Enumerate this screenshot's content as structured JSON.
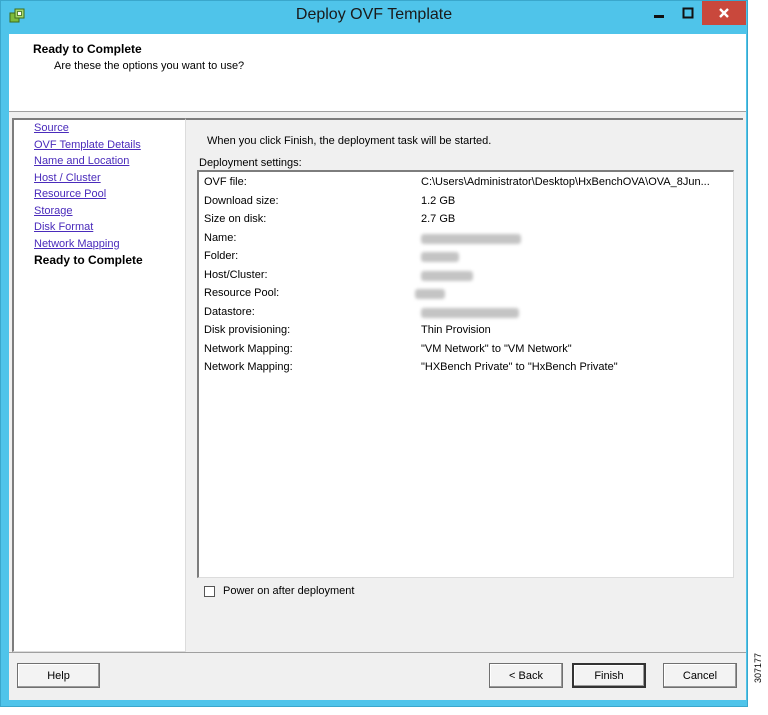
{
  "window": {
    "title": "Deploy OVF Template",
    "app_icon": "vsphere-deploy-icon",
    "controls": [
      "minimize-icon",
      "maximize-icon",
      "close-icon"
    ]
  },
  "header": {
    "title": "Ready to Complete",
    "subtitle": "Are these the options you want to use?"
  },
  "nav": {
    "items": [
      {
        "label": "Source"
      },
      {
        "label": "OVF Template Details"
      },
      {
        "label": "Name and Location"
      },
      {
        "label": "Host / Cluster"
      },
      {
        "label": "Resource Pool"
      },
      {
        "label": "Storage"
      },
      {
        "label": "Disk Format"
      },
      {
        "label": "Network Mapping"
      },
      {
        "label": "Ready to Complete"
      }
    ],
    "current_index": 8
  },
  "main": {
    "intro": "When you click Finish, the deployment task will be started.",
    "settings_label": "Deployment settings:",
    "settings": [
      {
        "key": "OVF file:",
        "value": "C:\\Users\\Administrator\\Desktop\\HxBenchOVA\\OVA_8Jun..."
      },
      {
        "key": "Download size:",
        "value": "1.2 GB"
      },
      {
        "key": "Size on disk:",
        "value": "2.7 GB"
      },
      {
        "key": "Name:",
        "value": ""
      },
      {
        "key": "Folder:",
        "value": ""
      },
      {
        "key": "Host/Cluster:",
        "value": ""
      },
      {
        "key": "Resource Pool:",
        "value": ""
      },
      {
        "key": "Datastore:",
        "value": ""
      },
      {
        "key": "Disk provisioning:",
        "value": "Thin Provision"
      },
      {
        "key": "Network Mapping:",
        "value": "\"VM Network\" to \"VM Network\""
      },
      {
        "key": "Network Mapping:",
        "value": "\"HXBench Private\" to \"HxBench Private\""
      }
    ],
    "power_on_label": "Power on after deployment",
    "power_on_checked": false
  },
  "buttons": {
    "help": "Help",
    "back": "< Back",
    "finish": "Finish",
    "cancel": "Cancel"
  },
  "figure_id": "307177"
}
